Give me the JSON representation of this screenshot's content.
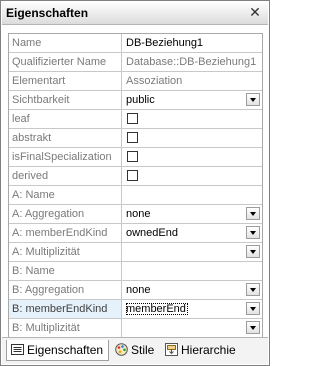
{
  "window": {
    "title": "Eigenschaften",
    "close_label": "✕"
  },
  "properties": [
    {
      "label": "Name",
      "value": "DB-Beziehung1",
      "type": "text",
      "readonly": false
    },
    {
      "label": "Qualifizierter Name",
      "value": "Database::DB-Beziehung1",
      "type": "text",
      "readonly": true
    },
    {
      "label": "Elementart",
      "value": "Assoziation",
      "type": "text",
      "readonly": true
    },
    {
      "label": "Sichtbarkeit",
      "value": "public",
      "type": "dropdown",
      "readonly": false
    },
    {
      "label": "leaf",
      "checked": false,
      "type": "checkbox"
    },
    {
      "label": "abstrakt",
      "checked": false,
      "type": "checkbox"
    },
    {
      "label": "isFinalSpecialization",
      "checked": false,
      "type": "checkbox"
    },
    {
      "label": "derived",
      "checked": false,
      "type": "checkbox"
    },
    {
      "label": "A: Name",
      "value": "",
      "type": "text",
      "readonly": false
    },
    {
      "label": "A: Aggregation",
      "value": "none",
      "type": "dropdown",
      "readonly": false
    },
    {
      "label": "A: memberEndKind",
      "value": "ownedEnd",
      "type": "dropdown",
      "readonly": false
    },
    {
      "label": "A: Multiplizität",
      "value": "",
      "type": "dropdown",
      "readonly": false
    },
    {
      "label": "B: Name",
      "value": "",
      "type": "text",
      "readonly": false
    },
    {
      "label": "B: Aggregation",
      "value": "none",
      "type": "dropdown",
      "readonly": false
    },
    {
      "label": "B: memberEndKind",
      "value": "memberEnd",
      "type": "dropdown",
      "readonly": false,
      "selected": true
    },
    {
      "label": "B: Multiplizität",
      "value": "",
      "type": "dropdown",
      "readonly": false
    }
  ],
  "tabs": [
    {
      "label": "Eigenschaften",
      "icon": "properties-icon",
      "active": true
    },
    {
      "label": "Stile",
      "icon": "palette-icon",
      "active": false
    },
    {
      "label": "Hierarchie",
      "icon": "hierarchy-icon",
      "active": false
    }
  ]
}
